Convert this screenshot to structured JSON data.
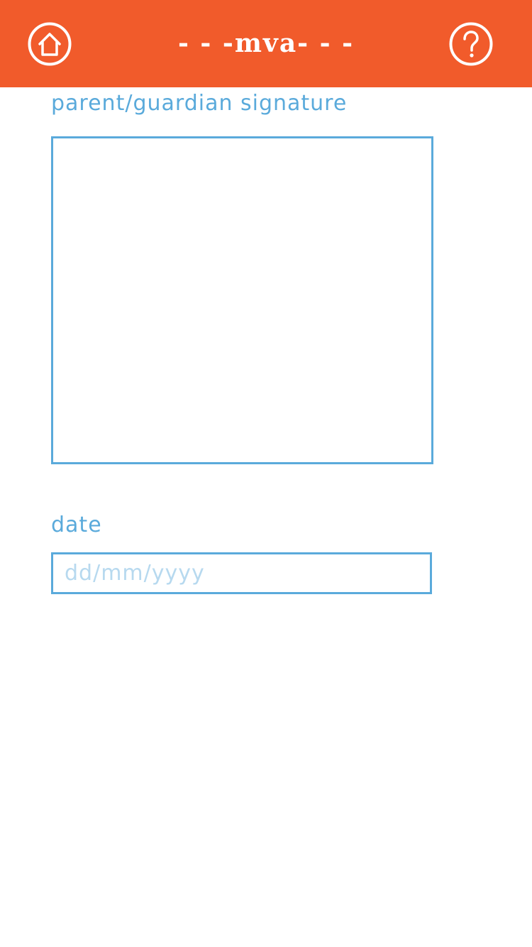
{
  "header": {
    "title": "- - -mva- - -",
    "background_color": "#f15b2b",
    "home_icon": "home-icon",
    "help_icon": "question-mark-icon"
  },
  "form": {
    "signature_label": "parent/guardian signature",
    "date_label": "date",
    "date_value": "",
    "date_placeholder": "dd/mm/yyyy",
    "accent_color": "#5aaadb"
  }
}
